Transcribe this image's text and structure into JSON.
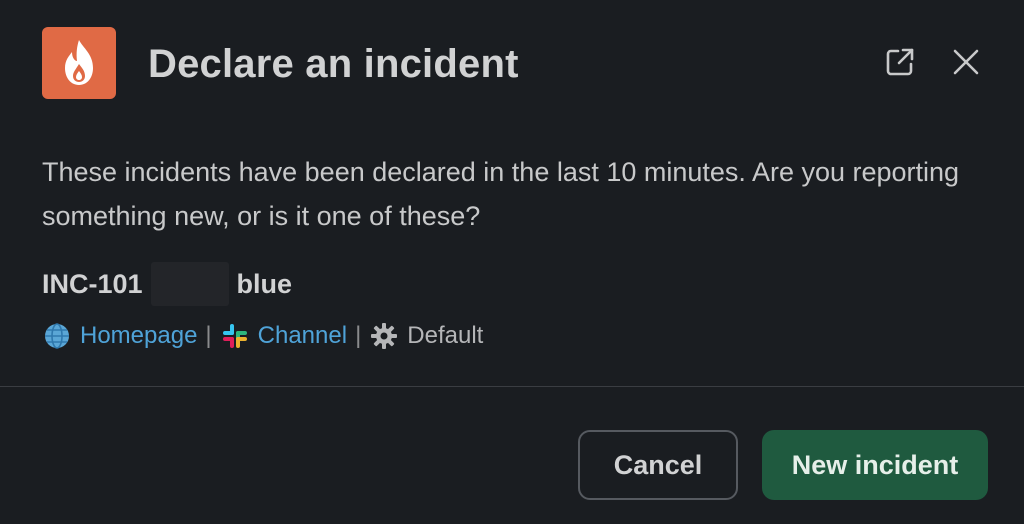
{
  "header": {
    "title": "Declare an incident",
    "app_icon": "flame-icon",
    "app_icon_color": "#e06a45",
    "external_icon": "open-external-icon",
    "close_icon": "close-icon"
  },
  "body": {
    "message": "These incidents have been declared in the last 10 minutes. Are you reporting something new, or is it one of these?"
  },
  "incident": {
    "id": "INC-101",
    "name": "blue",
    "links": {
      "homepage": "Homepage",
      "channel": "Channel",
      "severity": "Default",
      "separator": "|"
    }
  },
  "footer": {
    "cancel_label": "Cancel",
    "primary_label": "New incident",
    "primary_color": "#1f5a3f",
    "link_color": "#4fa3d8"
  }
}
